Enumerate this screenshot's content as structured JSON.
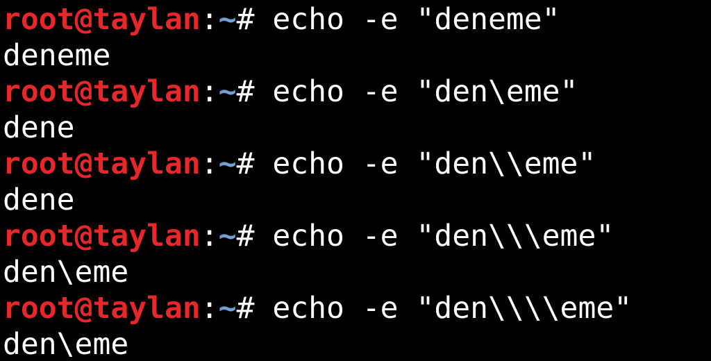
{
  "terminal": {
    "user_host": "root@taylan",
    "separator": ":",
    "path": "~",
    "prompt_char": "# ",
    "colors": {
      "background": "#000000",
      "user_host": "#e8272a",
      "path": "#6f9fd8",
      "text": "#ffffff"
    },
    "entries": [
      {
        "command": "echo -e \"deneme\"",
        "output": "deneme"
      },
      {
        "command": "echo -e \"den\\eme\"",
        "output": "dene"
      },
      {
        "command": "echo -e \"den\\\\eme\"",
        "output": "dene"
      },
      {
        "command": "echo -e \"den\\\\\\eme\"",
        "output": "den\\eme"
      },
      {
        "command": "echo -e \"den\\\\\\\\eme\"",
        "output": "den\\eme"
      }
    ]
  }
}
